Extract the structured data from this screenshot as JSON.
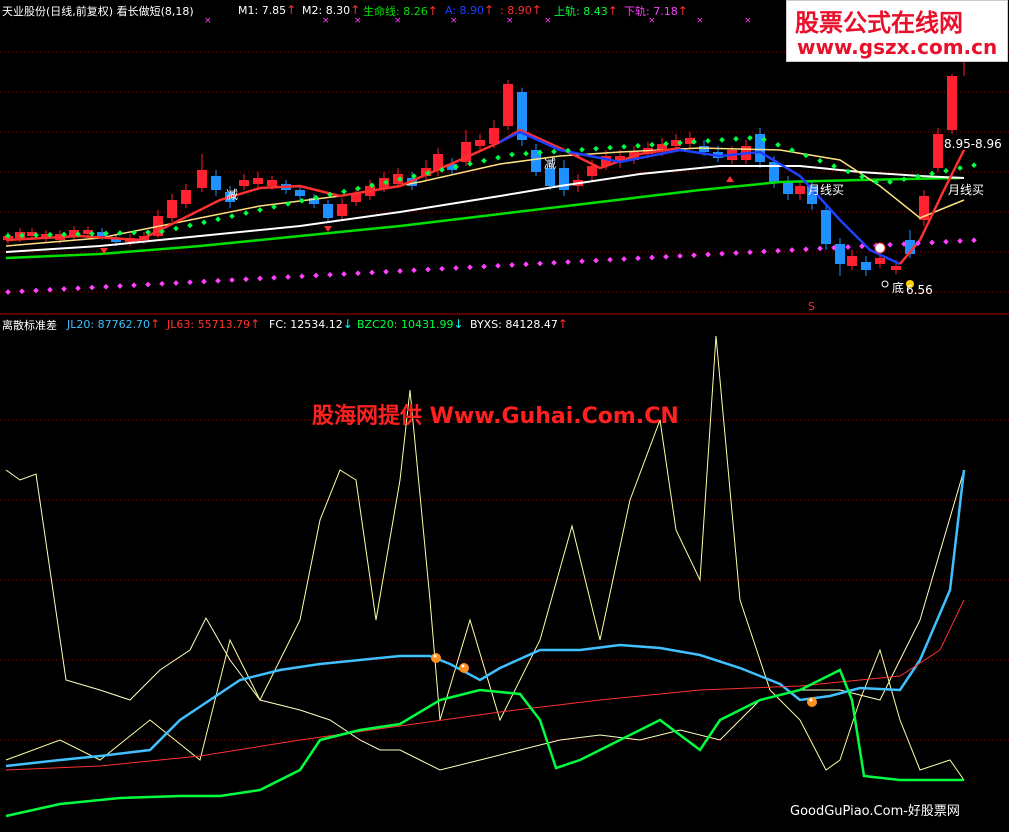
{
  "header_top": {
    "title": "天业股份(日线,前复权) 看长做短(8,18)",
    "items": [
      {
        "label": "M1: 7.85",
        "color": "#ffffff",
        "arrow": "up"
      },
      {
        "label": "M2: 8.30",
        "color": "#ffffff",
        "arrow": "up"
      },
      {
        "label": "生命线: 8.26",
        "color": "#00e000",
        "arrow": "up"
      },
      {
        "label": "A: 8.90",
        "color": "#2040ff",
        "arrow": "up"
      },
      {
        "label": ": 8.90",
        "color": "#ff3030",
        "arrow": "up"
      },
      {
        "label": "上轨: 8.43",
        "color": "#00ff40",
        "arrow": "up"
      },
      {
        "label": "下轨: 7.18",
        "color": "#ff40ff",
        "arrow": "up"
      }
    ]
  },
  "header_bottom": {
    "title": "离散标准差",
    "items": [
      {
        "label": "JL20: 87762.70",
        "color": "#40c0ff",
        "arrow": "up"
      },
      {
        "label": "JL63: 55713.79",
        "color": "#ff3030",
        "arrow": "up"
      },
      {
        "label": "FC: 12534.12",
        "color": "#ffffff",
        "arrow": "down"
      },
      {
        "label": "BZC20: 10431.99",
        "color": "#00ff40",
        "arrow": "down"
      },
      {
        "label": "BYXS: 84128.47",
        "color": "#ffffff",
        "arrow": "up"
      }
    ]
  },
  "annotations": {
    "jian1": "减",
    "jian2": "减",
    "yue1": "月线买",
    "yue2": "月线买",
    "price_range": "8.95-8.96",
    "di": "底",
    "low": "6.56",
    "s_marker": "S"
  },
  "watermarks": {
    "top_line1": "股票公式在线网",
    "top_line2": "www.gszx.com.cn",
    "mid": "股海网提供 Www.Guhai.Com.CN",
    "bottom": "GoodGuPiao.Com-好股票网"
  },
  "colors": {
    "background": "#000000",
    "grid": "#8b0000",
    "up": "#ff2030",
    "down": "#1e90ff",
    "life_line": "#00e000",
    "upper_band": "#00ff40",
    "lower_band": "#ff40ff",
    "jl20": "#40c0ff",
    "jl63": "#ff3030",
    "bzc20": "#00ff40",
    "fc": "#ffffa0"
  }
}
